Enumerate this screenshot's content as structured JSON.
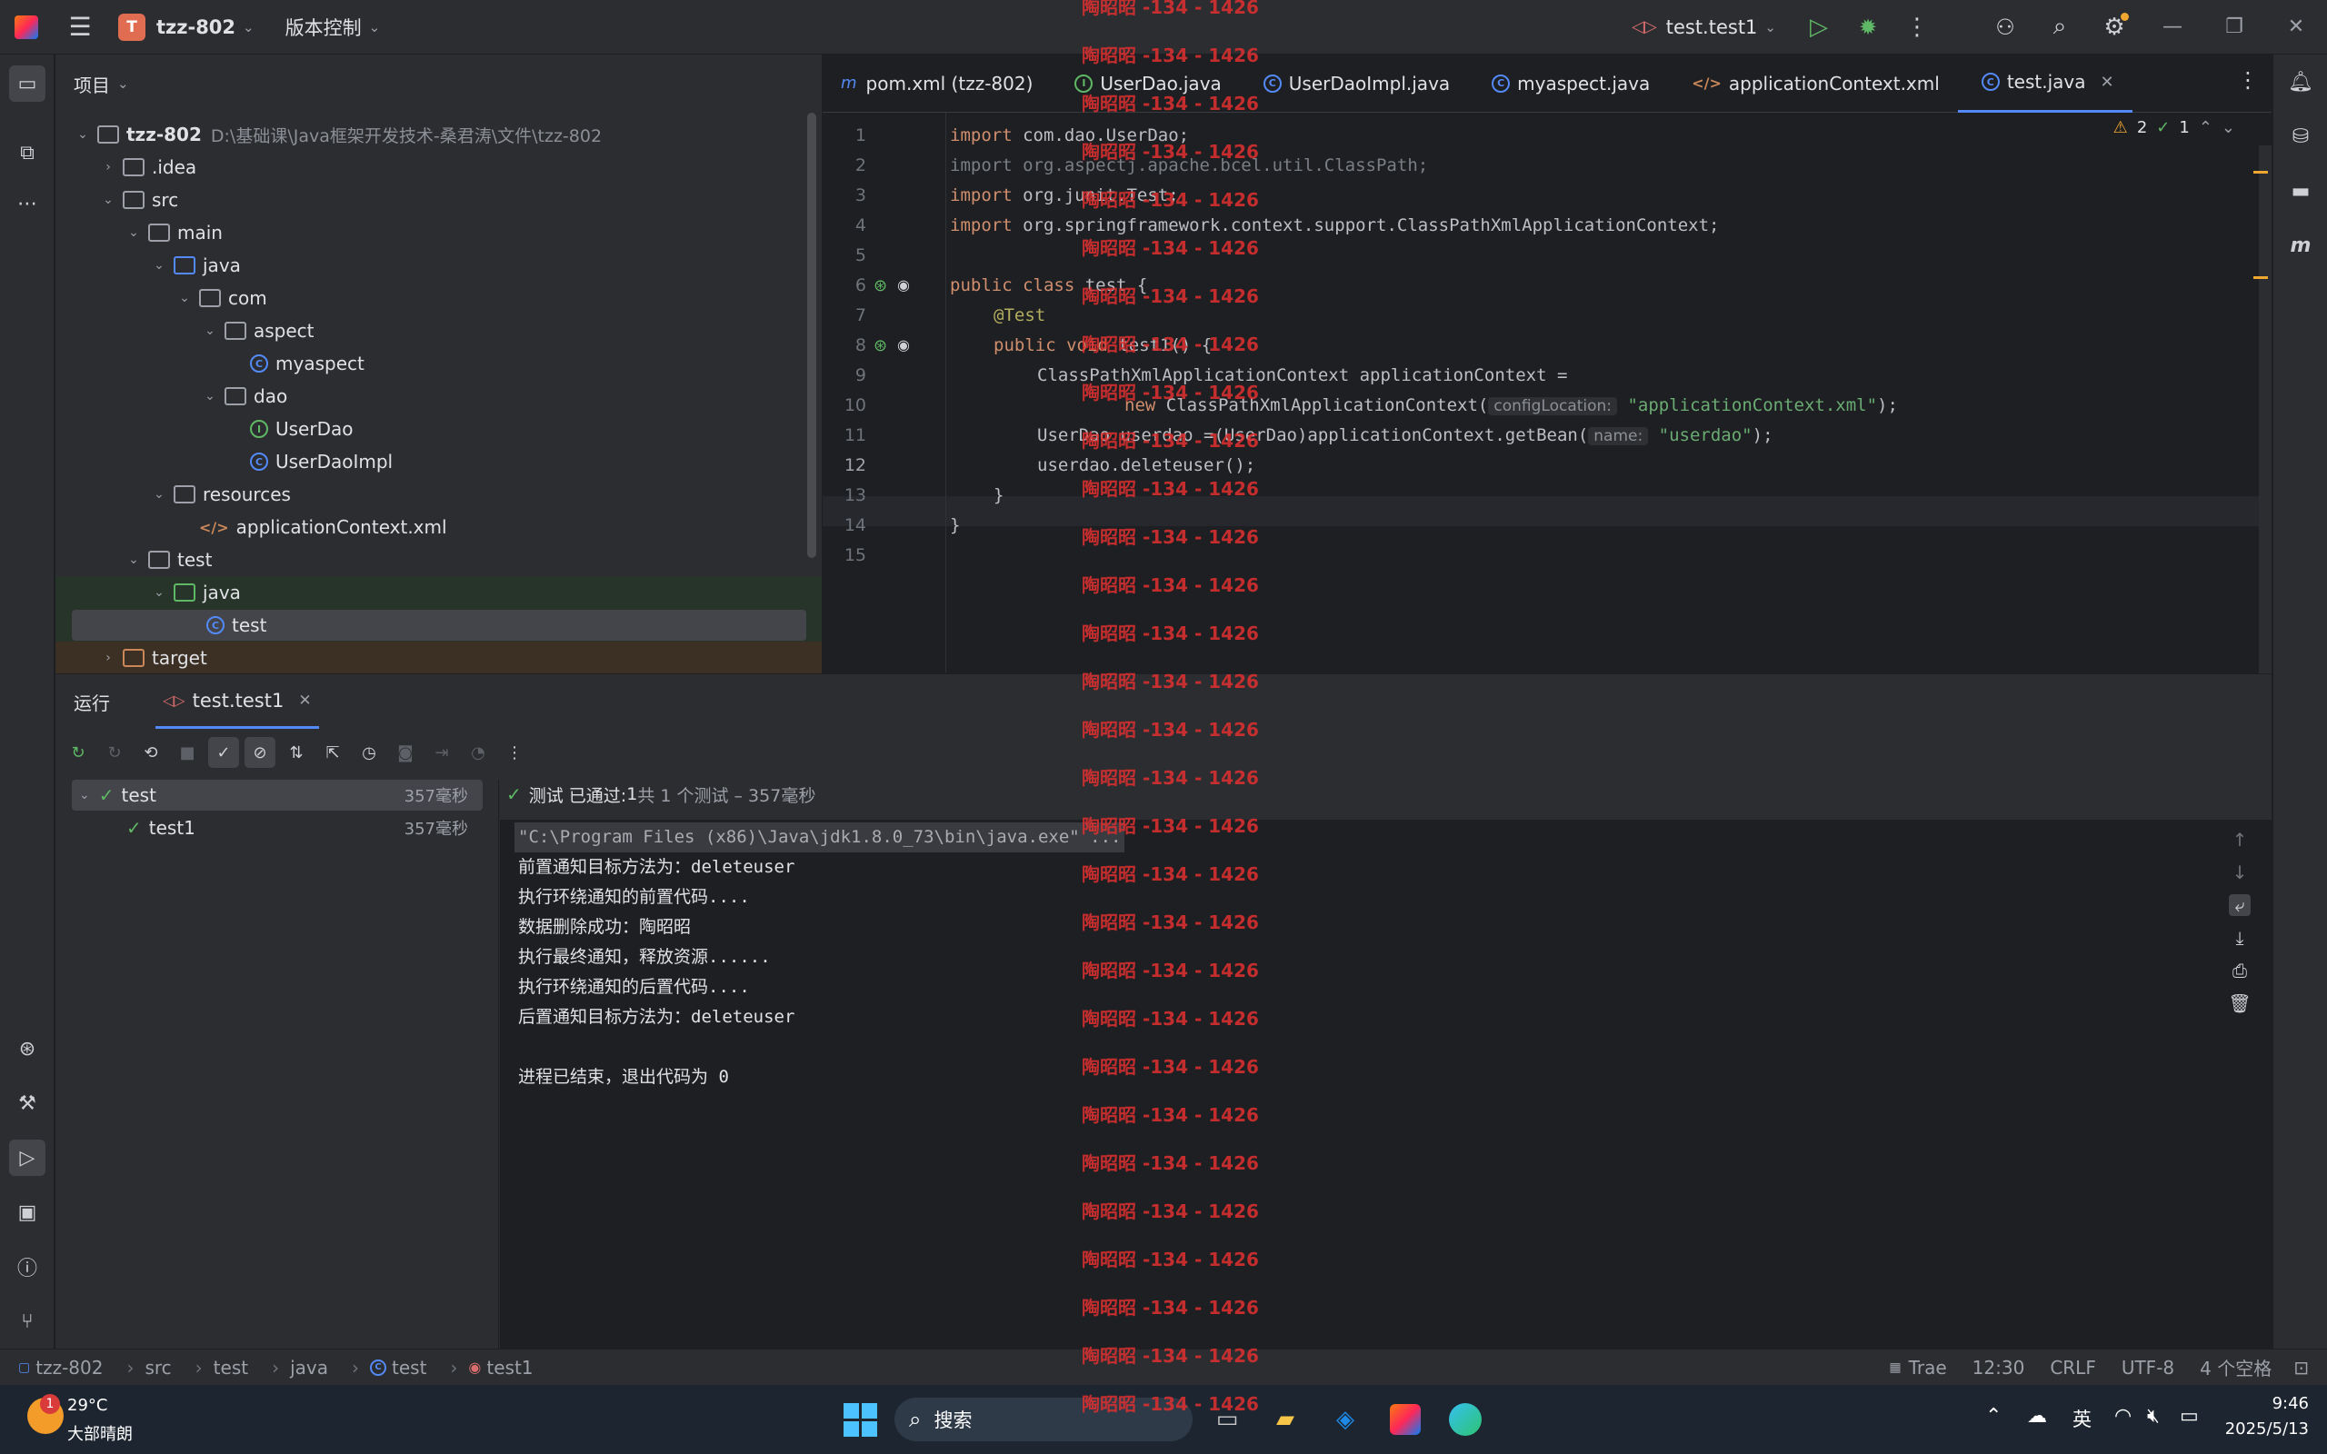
{
  "titlebar": {
    "project_badge": "T",
    "project_name": "tzz-802",
    "vcs_menu": "版本控制",
    "run_config": "test.test1"
  },
  "project_panel": {
    "header": "项目",
    "root_name": "tzz-802",
    "root_path": "D:\\基础课\\Java框架开发技术-桑君涛\\文件\\tzz-802",
    "items": [
      {
        "label": ".idea"
      },
      {
        "label": "src"
      },
      {
        "label": "main"
      },
      {
        "label": "java"
      },
      {
        "label": "com"
      },
      {
        "label": "aspect"
      },
      {
        "label": "myaspect"
      },
      {
        "label": "dao"
      },
      {
        "label": "UserDao"
      },
      {
        "label": "UserDaoImpl"
      },
      {
        "label": "resources"
      },
      {
        "label": "applicationContext.xml"
      },
      {
        "label": "test"
      },
      {
        "label": "java"
      },
      {
        "label": "test"
      },
      {
        "label": "target"
      }
    ]
  },
  "editor": {
    "tabs": [
      {
        "label": "pom.xml (tzz-802)"
      },
      {
        "label": "UserDao.java"
      },
      {
        "label": "UserDaoImpl.java"
      },
      {
        "label": "myaspect.java"
      },
      {
        "label": "applicationContext.xml"
      },
      {
        "label": "test.java"
      }
    ],
    "warnings_count": "2",
    "ok_count": "1",
    "line_numbers": [
      "1",
      "2",
      "3",
      "4",
      "5",
      "6",
      "7",
      "8",
      "9",
      "10",
      "11",
      "12",
      "13",
      "14",
      "15"
    ],
    "code": {
      "l1_kw": "import",
      "l1_rest": " com.dao.UserDao;",
      "l2": "import org.aspectj.apache.bcel.util.ClassPath;",
      "l3_kw": "import",
      "l3_rest": " org.junit.Test;",
      "l4_kw": "import",
      "l4_rest": " org.springframework.context.support.ClassPathXmlApplicationContext;",
      "l6_kw": "public class",
      "l6_rest": " test {",
      "l7": "@Test",
      "l8_kw": "public void",
      "l8_rest": " test1() {",
      "l9": "ClassPathXmlApplicationContext applicationContext =",
      "l10_kw": "new",
      "l10_rest": " ClassPathXmlApplicationContext(",
      "l10_hint": "configLocation:",
      "l10_str": "\"applicationContext.xml\"",
      "l10_end": ");",
      "l11_a": "UserDao userdao =(UserDao)applicationContext.getBean(",
      "l11_hint": "name:",
      "l11_str": "\"userdao\"",
      "l11_end": ");",
      "l12": "userdao.deleteuser();",
      "l13": "}",
      "l14": "}"
    }
  },
  "run_panel": {
    "title": "运行",
    "tab_label": "test.test1",
    "summary_prefix": "测试 已通过:",
    "summary_count": "1",
    "summary_suffix": "共 1 个测试 – 357毫秒",
    "tree": [
      {
        "label": "test",
        "duration": "357毫秒"
      },
      {
        "label": "test1",
        "duration": "357毫秒"
      }
    ],
    "console_lines": [
      "\"C:\\Program Files (x86)\\Java\\jdk1.8.0_73\\bin\\java.exe\" ...",
      "前置通知目标方法为：deleteuser",
      "执行环绕通知的前置代码....",
      "数据删除成功：陶昭昭",
      "执行最终通知，释放资源......",
      "执行环绕通知的后置代码....",
      "后置通知目标方法为：deleteuser",
      "",
      "进程已结束，退出代码为 0"
    ]
  },
  "statusbar": {
    "breadcrumbs": [
      "tzz-802",
      "src",
      "test",
      "java",
      "test",
      "test1"
    ],
    "encoding_mode": "Trae",
    "position": "12:30",
    "line_sep": "CRLF",
    "encoding": "UTF-8",
    "indent": "4 个空格"
  },
  "taskbar": {
    "weather_badge": "1",
    "temperature": "29°C",
    "weather": "大部晴朗",
    "search_label": "搜索",
    "ime": "英",
    "time": "9:46",
    "date": "2025/5/13"
  },
  "watermark": "陶昭昭 -134 - 1426"
}
